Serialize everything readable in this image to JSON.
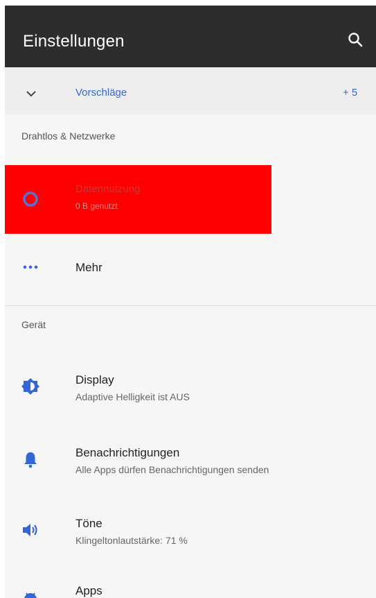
{
  "appbar": {
    "title": "Einstellungen",
    "search_icon": "search-icon"
  },
  "suggestions": {
    "label": "Vorschläge",
    "count": "+ 5"
  },
  "sections": {
    "wireless": "Drahtlos & Netzwerke",
    "device": "Gerät"
  },
  "items": {
    "data_usage": {
      "title": "Datennutzung",
      "subtitle": "0 B genutzt"
    },
    "more": {
      "title": "Mehr"
    },
    "display": {
      "title": "Display",
      "subtitle": "Adaptive Helligkeit ist AUS"
    },
    "notifications": {
      "title": "Benachrichtigungen",
      "subtitle": "Alle Apps dürfen Benachrichtigungen senden"
    },
    "sound": {
      "title": "Töne",
      "subtitle": "Klingeltonlautstärke: 71 %"
    },
    "apps": {
      "title": "Apps"
    }
  },
  "colors": {
    "accent": "#3367d6",
    "appbar": "#2d2d2d",
    "highlight": "#ff0000"
  }
}
